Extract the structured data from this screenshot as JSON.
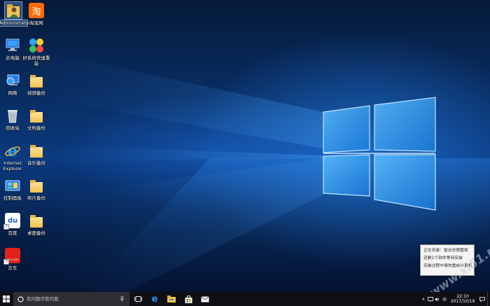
{
  "desktop": {
    "icons": [
      {
        "label": "Administrator"
      },
      {
        "label": "此电脑"
      },
      {
        "label": "网络"
      },
      {
        "label": "回收站"
      },
      {
        "label": "Internet Explorer"
      },
      {
        "label": "控制面板"
      },
      {
        "label": "百度"
      },
      {
        "label": "京东"
      },
      {
        "label": "淘宝网"
      },
      {
        "label": "好系统快速重装"
      },
      {
        "label": "视频备份"
      },
      {
        "label": "文档备份"
      },
      {
        "label": "音乐备份"
      },
      {
        "label": "照片备份"
      },
      {
        "label": "桌面备份"
      }
    ],
    "jd_badge": "JD.COM",
    "taobao_glyph": "淘",
    "baidu_glyph": "du"
  },
  "notification": {
    "line1": "正在安装：驱动总裁管家",
    "line2": "还剩1个软件等待安装",
    "line3": "安装过程中请勿重启计算机"
  },
  "watermark": "www.xi51.net",
  "taskbar": {
    "search_placeholder": "有问题尽管问我",
    "time": "22:10",
    "date": "2017/10/19"
  },
  "colors": {
    "taskbar_bg": "#0f0f14",
    "accent_blue": "#1e90ff",
    "folder_yellow": "#f3c04f"
  }
}
